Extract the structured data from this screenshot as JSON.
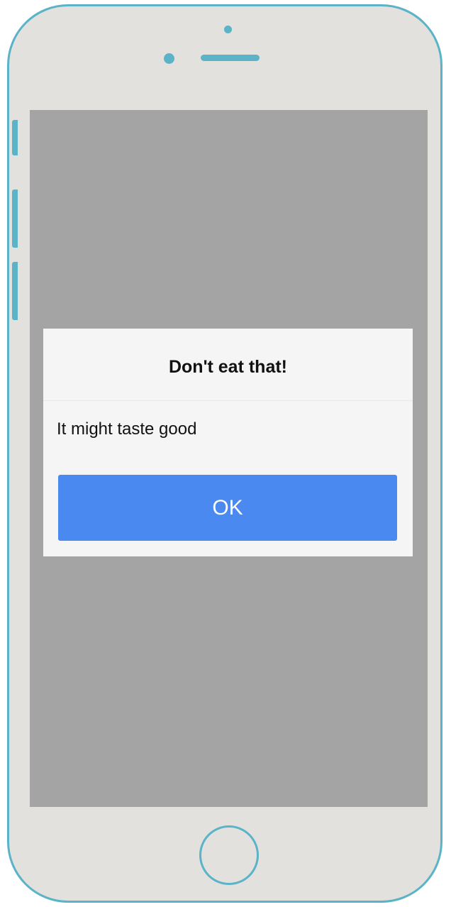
{
  "dialog": {
    "title": "Don't eat that!",
    "message": "It might taste good",
    "ok_label": "OK"
  },
  "colors": {
    "phone_frame": "#5bb3c8",
    "phone_body": "#e3e1de",
    "screen_overlay": "#a4a4a4",
    "dialog_background": "#f5f5f5",
    "ok_button": "#4a89f0"
  },
  "icons": {
    "front_camera": "camera-dot-icon",
    "sensor": "sensor-dot-icon",
    "speaker": "speaker-grille-icon",
    "home": "home-button-icon"
  }
}
